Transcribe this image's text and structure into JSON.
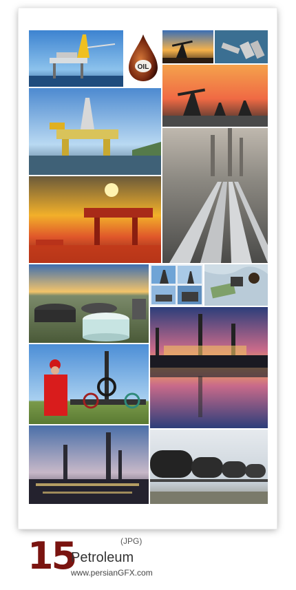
{
  "collection": {
    "count": "15",
    "format": "(JPG)",
    "title": "Petroleum",
    "website": "www.persianGFX.com"
  },
  "logo": {
    "badge_text": "OIL"
  },
  "colors": {
    "number": "#7a1410",
    "sky_sunset": "#f29a4a",
    "sky_blue": "#4f86c6",
    "refinery_night": "#1e1c2e"
  }
}
